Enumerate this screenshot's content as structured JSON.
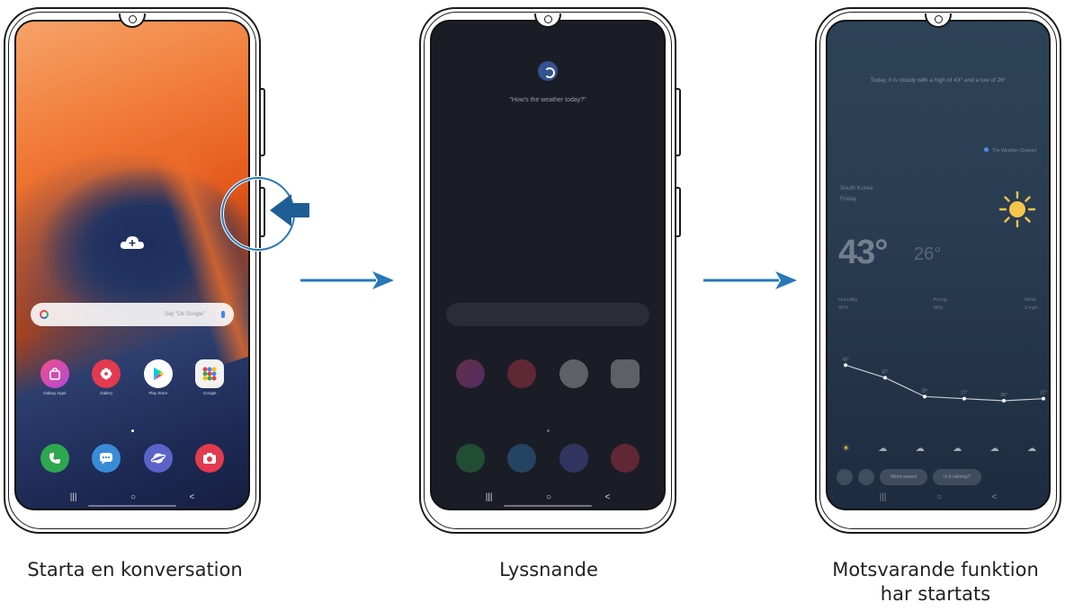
{
  "steps": [
    {
      "caption": "Starta en konversation",
      "screen": {
        "search_placeholder": "Say \"Ok Google\"",
        "apps_row1": [
          {
            "label": "Galaxy Apps",
            "icon": "shopping-bag-icon",
            "color": "#e04a8c"
          },
          {
            "label": "Gallery",
            "icon": "flower-icon",
            "color": "#e23a4e"
          },
          {
            "label": "Play Store",
            "icon": "play-store-icon",
            "color": "#ffffff"
          },
          {
            "label": "Google",
            "icon": "google-folder-icon",
            "color": "#f2f2f2"
          }
        ],
        "apps_row2": [
          {
            "label": "",
            "icon": "phone-icon",
            "color": "#2ea84f"
          },
          {
            "label": "",
            "icon": "messages-icon",
            "color": "#3a8bd6"
          },
          {
            "label": "",
            "icon": "internet-icon",
            "color": "#5b63c9"
          },
          {
            "label": "",
            "icon": "camera-icon",
            "color": "#e23a4e"
          }
        ]
      }
    },
    {
      "caption": "Lyssnande",
      "screen": {
        "prompt": "\"How's the weather today?\""
      }
    },
    {
      "caption": "Motsvarande funktion\nhar startats",
      "screen": {
        "summary": "Today, it is cloudy with a high of 43° and a low of 26°",
        "attribution": "The Weather Channel",
        "location": "South Korea",
        "day": "Friday",
        "temp_high": "43°",
        "temp_low": "26°",
        "condition": "Cloudy",
        "stats": [
          {
            "label": "Humidity",
            "value": "40%"
          },
          {
            "label": "Precip.",
            "value": "38%"
          },
          {
            "label": "Wind",
            "value": "3 mph"
          }
        ],
        "forecast_temps": [
          43,
          37,
          28,
          27,
          26,
          27
        ],
        "forecast_icons": [
          "☀",
          "☁",
          "☁",
          "☁",
          "☁",
          "☁"
        ],
        "actions": [
          "Wind speed",
          "Is it raining?"
        ]
      }
    }
  ],
  "nav_buttons": [
    "|||",
    "○",
    "<"
  ]
}
